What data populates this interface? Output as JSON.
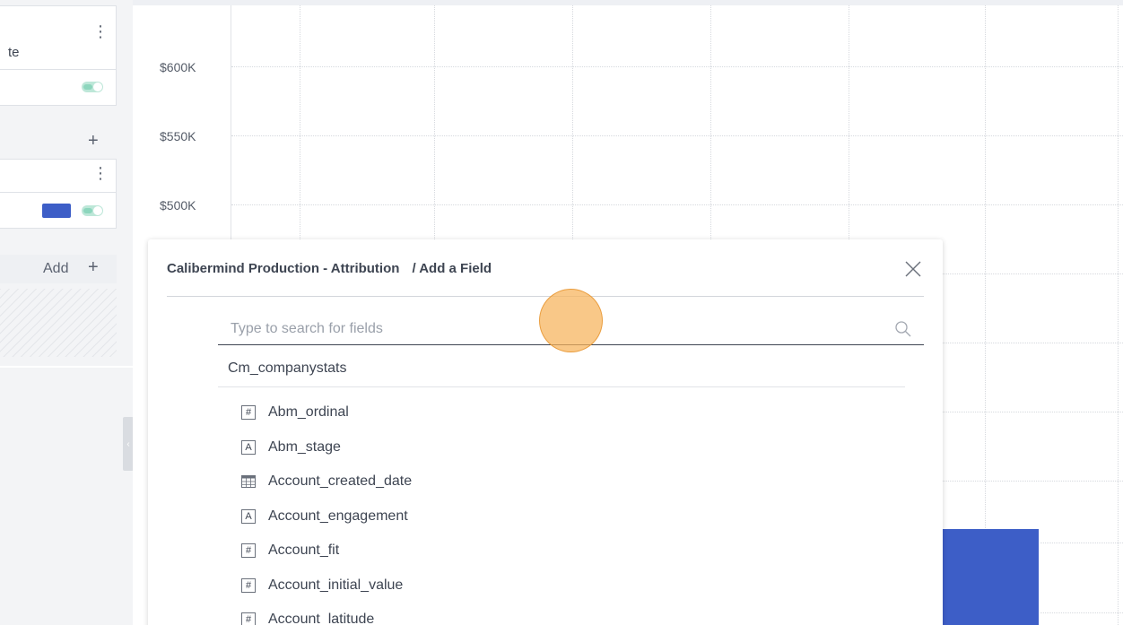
{
  "sidebar": {
    "card1": {
      "label": "te"
    },
    "add_section": {
      "label": "Add"
    }
  },
  "colors": {
    "accent_blue": "#3d5ec7",
    "toggle_green": "#8dd6bd",
    "click_indicator": "#f7b35a"
  },
  "chart": {
    "y_ticks": [
      "$600K",
      "$550K",
      "$500K"
    ]
  },
  "chart_data": {
    "type": "bar",
    "yticks": [
      "$600K",
      "$550K",
      "$500K"
    ],
    "series_color": "#3d5ec7"
  },
  "modal": {
    "breadcrumb_source": "Calibermind Production - Attribution",
    "breadcrumb_page": "/ Add a Field",
    "close_icon": "close-icon",
    "search": {
      "placeholder": "Type to search for fields",
      "value": ""
    },
    "group_label": "Cm_companystats",
    "fields": [
      {
        "name": "Abm_ordinal",
        "type": "number",
        "icon": "#"
      },
      {
        "name": "Abm_stage",
        "type": "text",
        "icon": "A"
      },
      {
        "name": "Account_created_date",
        "type": "date",
        "icon": "calendar"
      },
      {
        "name": "Account_engagement",
        "type": "text",
        "icon": "A"
      },
      {
        "name": "Account_fit",
        "type": "number",
        "icon": "#"
      },
      {
        "name": "Account_initial_value",
        "type": "number",
        "icon": "#"
      },
      {
        "name": "Account_latitude",
        "type": "number",
        "icon": "#"
      }
    ]
  }
}
